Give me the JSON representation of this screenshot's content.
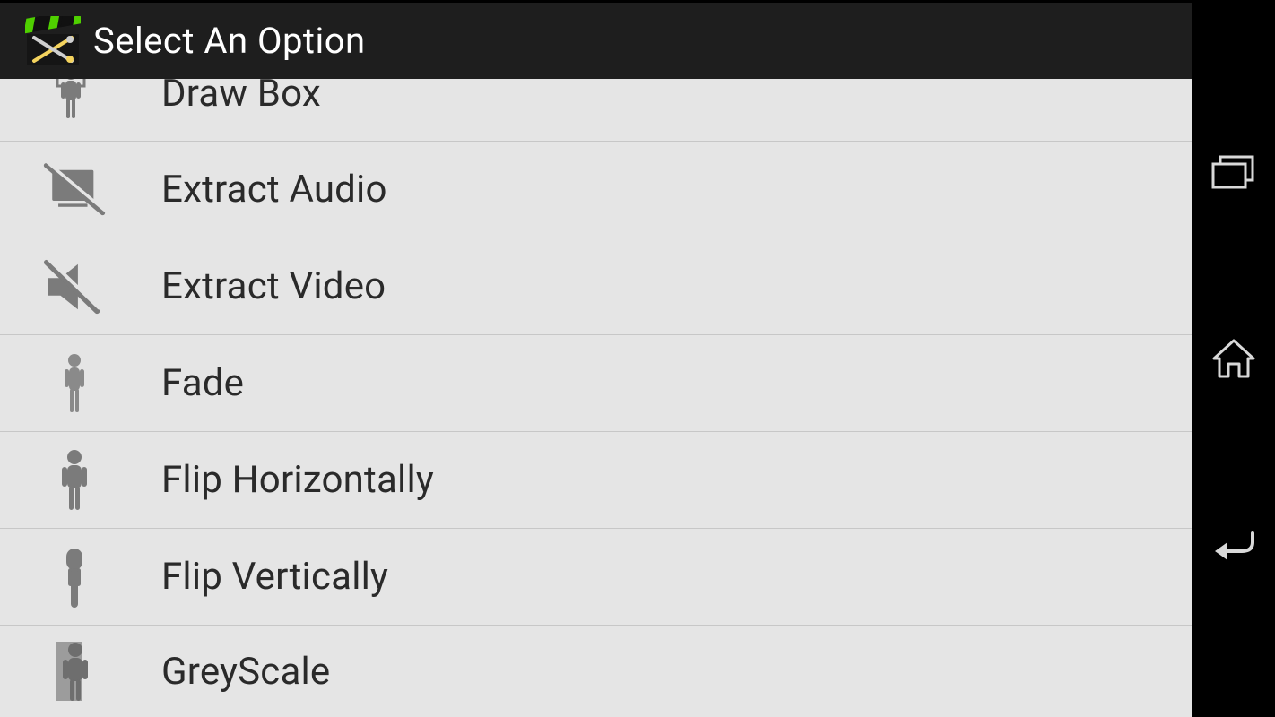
{
  "titlebar": {
    "title": "Select An Option",
    "app_icon_name": "video-editor-app-icon"
  },
  "options": [
    {
      "label": "Draw Box",
      "icon_name": "person-frame-icon"
    },
    {
      "label": "Extract Audio",
      "icon_name": "screen-off-icon"
    },
    {
      "label": "Extract Video",
      "icon_name": "volume-mute-icon"
    },
    {
      "label": "Fade",
      "icon_name": "person-thin-icon"
    },
    {
      "label": "Flip Horizontally",
      "icon_name": "person-solid-icon"
    },
    {
      "label": "Flip Vertically",
      "icon_name": "hand-down-icon"
    },
    {
      "label": "GreyScale",
      "icon_name": "person-shadow-icon"
    }
  ],
  "nav": {
    "recent_name": "recent-apps-icon",
    "home_name": "home-icon",
    "back_name": "back-icon"
  }
}
